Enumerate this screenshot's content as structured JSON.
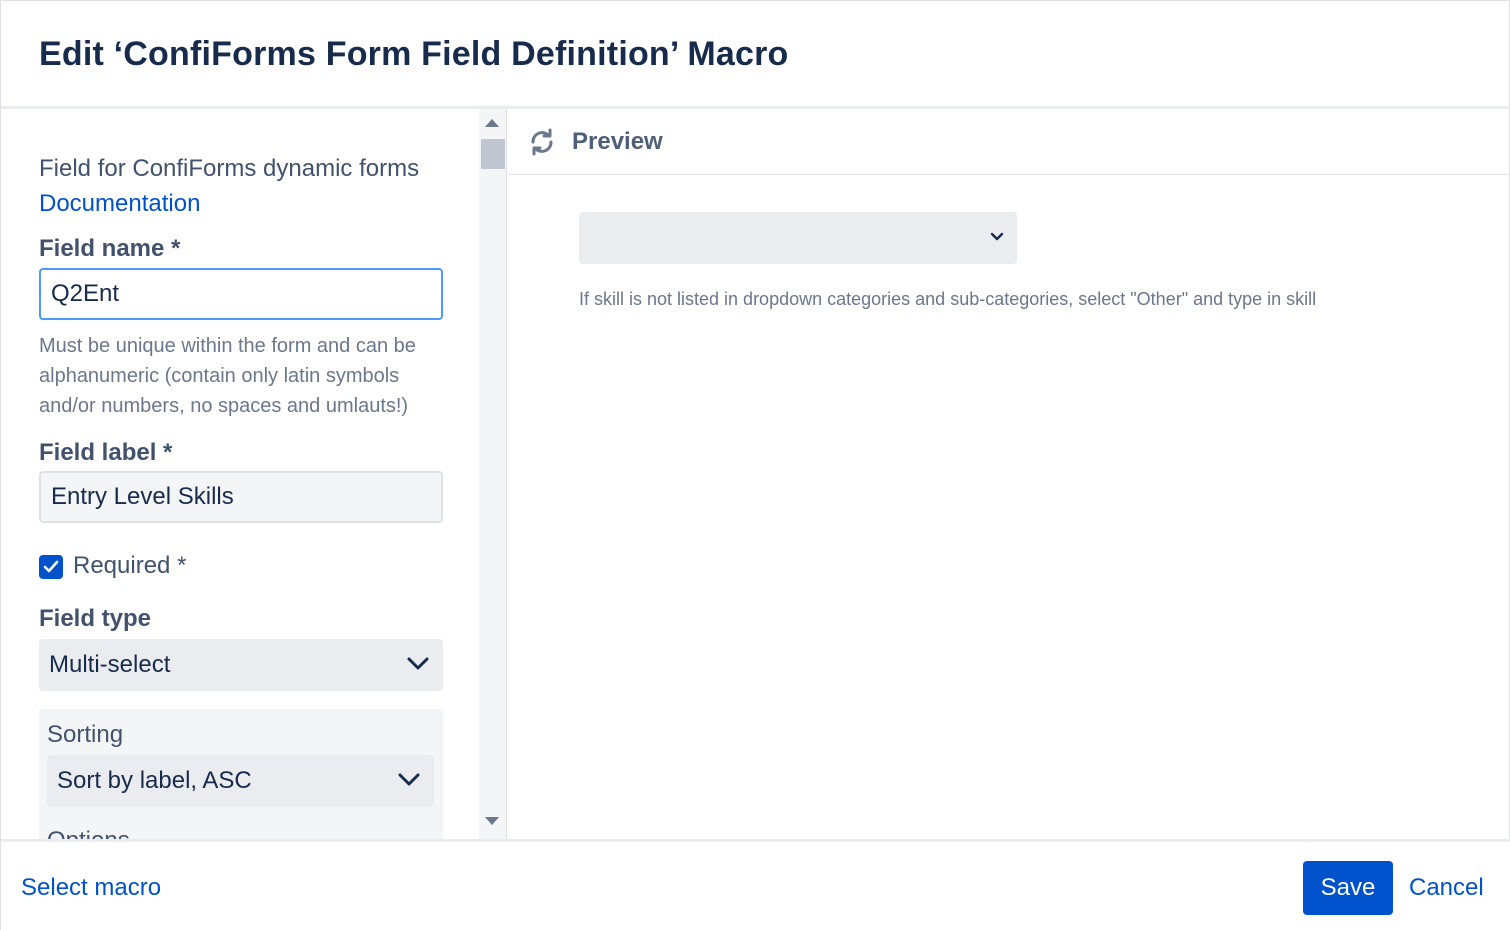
{
  "dialog": {
    "title": "Edit ‘ConfiForms Form Field Definition’ Macro"
  },
  "form": {
    "description": "Field for ConfiForms dynamic forms",
    "documentation_link": "Documentation",
    "field_name": {
      "label": "Field name *",
      "value": "Q2Ent",
      "help": "Must be unique within the form and can be alphanumeric (contain only latin symbols and/or numbers, no spaces and umlauts!)"
    },
    "field_label": {
      "label": "Field label *",
      "value": "Entry Level Skills"
    },
    "required": {
      "label": "Required *",
      "checked": true
    },
    "field_type": {
      "label": "Field type",
      "selected": "Multi-select"
    },
    "sorting": {
      "label": "Sorting",
      "selected": "Sort by label, ASC",
      "next_label_partial": "Options"
    }
  },
  "preview": {
    "title": "Preview",
    "select_value": "",
    "help_text": "If skill is not listed in dropdown categories and sub-categories, select \"Other\" and type in skill"
  },
  "footer": {
    "select_macro": "Select macro",
    "save": "Save",
    "cancel": "Cancel"
  },
  "colors": {
    "primary": "#0052cc",
    "focus": "#4c9aff",
    "text": "#172b4d",
    "muted": "#6b778c"
  }
}
